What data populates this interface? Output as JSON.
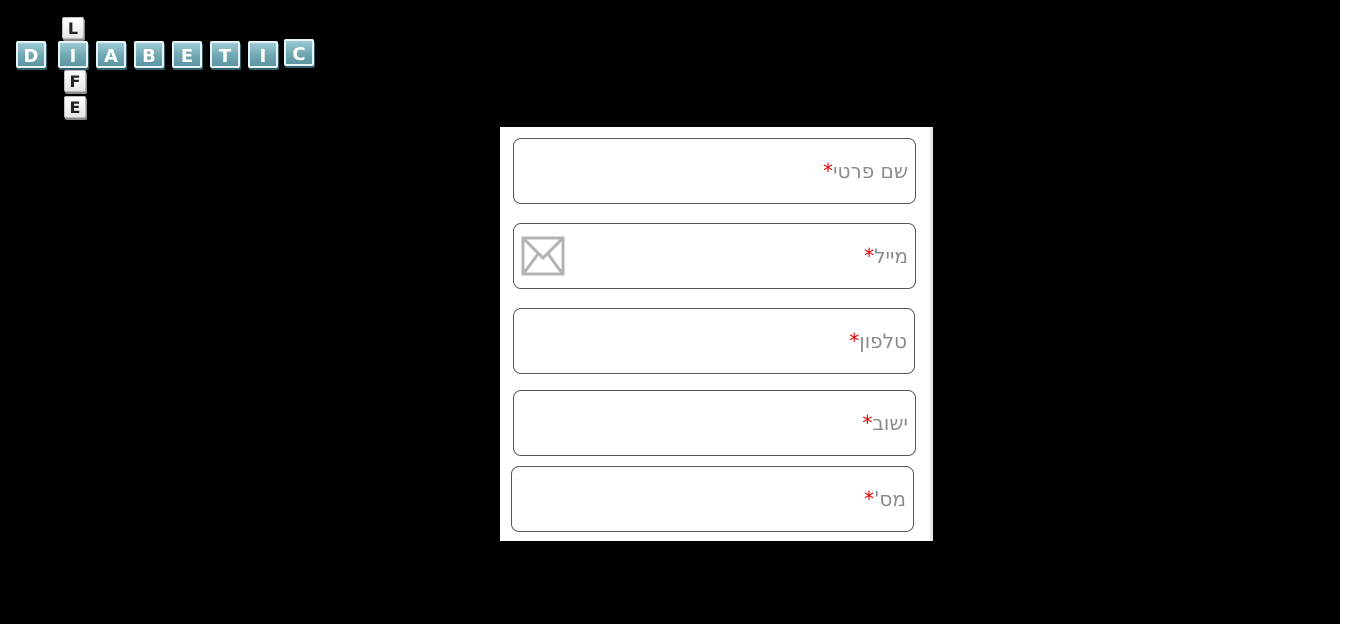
{
  "logo": {
    "across_letters": [
      "D",
      "I",
      "A",
      "B",
      "E",
      "T",
      "I",
      "C"
    ],
    "down_letters": [
      "L",
      "I",
      "F",
      "E"
    ]
  },
  "form": {
    "fields": [
      {
        "label": "שם פרטי",
        "required_mark": "*",
        "icon": null
      },
      {
        "label": "מייל",
        "required_mark": "*",
        "icon": "mail-icon"
      },
      {
        "label": "טלפון",
        "required_mark": "*",
        "icon": null
      },
      {
        "label": "ישוב",
        "required_mark": "*",
        "icon": null
      },
      {
        "label": "מס'",
        "required_mark": "*",
        "icon": null
      }
    ]
  },
  "colors": {
    "background": "#000000",
    "required": "#e60000",
    "label": "#8c8c8c",
    "tile_blue": "#6fa7b2"
  }
}
